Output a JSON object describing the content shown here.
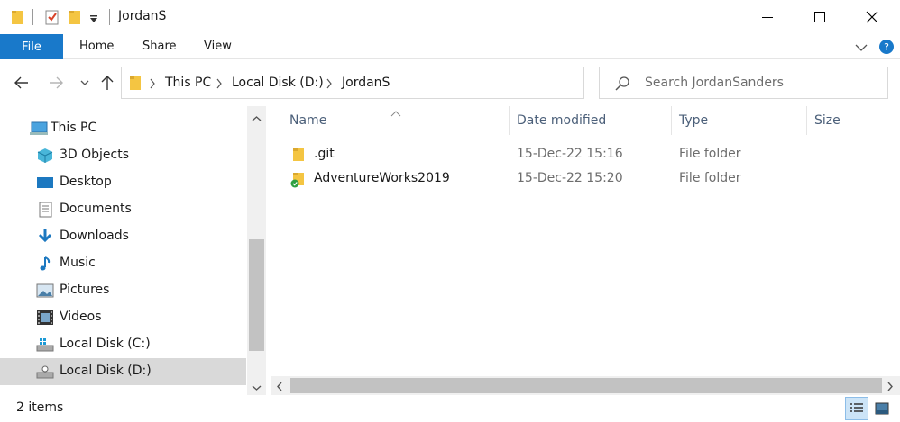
{
  "window": {
    "title": "JordanS"
  },
  "ribbon": {
    "file_label": "File",
    "tabs": [
      "Home",
      "Share",
      "View"
    ]
  },
  "address": {
    "crumbs": [
      "This PC",
      "Local Disk (D:)",
      "JordanS"
    ]
  },
  "search": {
    "placeholder": "Search JordanSanders"
  },
  "nav": {
    "items": [
      {
        "label": "This PC",
        "icon": "this-pc-icon"
      },
      {
        "label": "3D Objects",
        "icon": "3d-objects-icon"
      },
      {
        "label": "Desktop",
        "icon": "desktop-icon"
      },
      {
        "label": "Documents",
        "icon": "documents-icon"
      },
      {
        "label": "Downloads",
        "icon": "downloads-icon"
      },
      {
        "label": "Music",
        "icon": "music-icon"
      },
      {
        "label": "Pictures",
        "icon": "pictures-icon"
      },
      {
        "label": "Videos",
        "icon": "videos-icon"
      },
      {
        "label": "Local Disk (C:)",
        "icon": "drive-c-icon"
      },
      {
        "label": "Local Disk (D:)",
        "icon": "drive-d-icon"
      }
    ]
  },
  "columns": {
    "name": "Name",
    "date": "Date modified",
    "type": "Type",
    "size": "Size"
  },
  "files": [
    {
      "name": ".git",
      "date": "15-Dec-22 15:16",
      "type": "File folder",
      "icon": "folder-icon"
    },
    {
      "name": "AdventureWorks2019",
      "date": "15-Dec-22 15:20",
      "type": "File folder",
      "icon": "folder-synced-icon"
    }
  ],
  "status": {
    "item_count": "2 items"
  },
  "colors": {
    "accent": "#1979ca",
    "folder": "#f4c542",
    "selected": "#d9d9d9",
    "header_text": "#4c607a"
  }
}
